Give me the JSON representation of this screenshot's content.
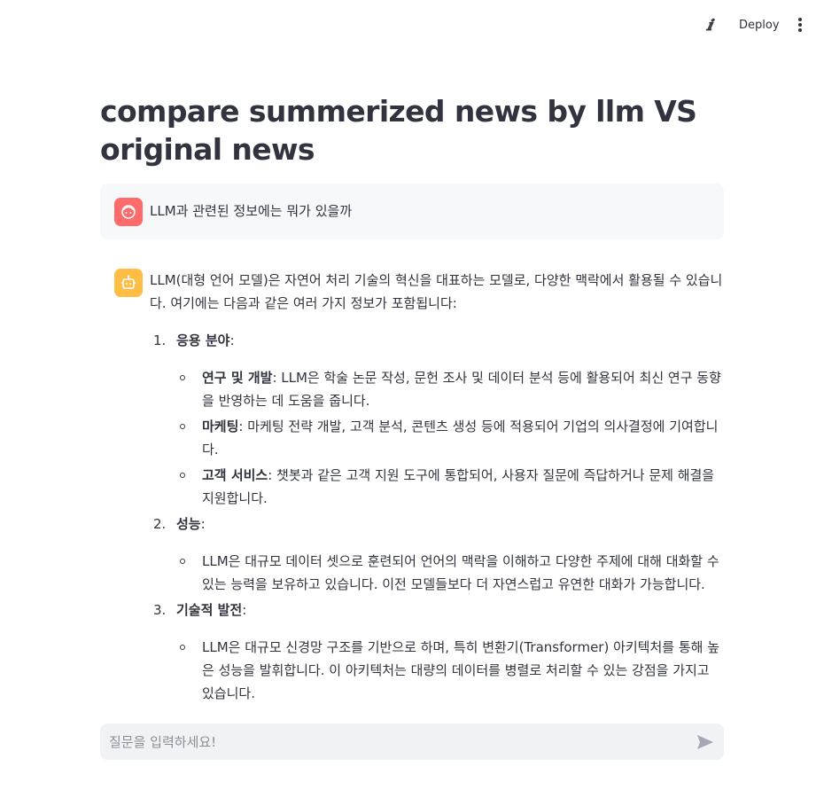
{
  "header": {
    "info_icon": "ⅈ",
    "deploy_label": "Deploy",
    "menu_icon": "vertical-ellipsis-icon"
  },
  "page": {
    "title": "compare summerized news by llm VS original news"
  },
  "messages": {
    "user": {
      "avatar_icon": "user-face-icon",
      "avatar_color": "#ff6b6b",
      "text": "LLM과 관련된 정보에는 뭐가 있을까"
    },
    "assistant": {
      "avatar_icon": "robot-icon",
      "avatar_color": "#ffbd45",
      "intro": "LLM(대형 언어 모델)은 자연어 처리 기술의 혁신을 대표하는 모델로, 다양한 맥락에서 활용될 수 있습니다. 여기에는 다음과 같은 여러 가지 정보가 포함됩니다:",
      "sections": [
        {
          "num": "1.",
          "heading": "응용 분야",
          "items": [
            {
              "label": "연구 및 개발",
              "text": ": LLM은 학술 논문 작성, 문헌 조사 및 데이터 분석 등에 활용되어 최신 연구 동향을 반영하는 데 도움을 줍니다."
            },
            {
              "label": "마케팅",
              "text": ": 마케팅 전략 개발, 고객 분석, 콘텐츠 생성 등에 적용되어 기업의 의사결정에 기여합니다."
            },
            {
              "label": "고객 서비스",
              "text": ": 챗봇과 같은 고객 지원 도구에 통합되어, 사용자 질문에 즉답하거나 문제 해결을 지원합니다."
            }
          ]
        },
        {
          "num": "2.",
          "heading": "성능",
          "items": [
            {
              "label": "",
              "text": "LLM은 대규모 데이터 셋으로 훈련되어 언어의 맥락을 이해하고 다양한 주제에 대해 대화할 수 있는 능력을 보유하고 있습니다. 이전 모델들보다 더 자연스럽고 유연한 대화가 가능합니다."
            }
          ]
        },
        {
          "num": "3.",
          "heading": "기술적 발전",
          "items": [
            {
              "label": "",
              "text": "LLM은 대규모 신경망 구조를 기반으로 하며, 특히 변환기(Transformer) 아키텍처를 통해 높은 성능을 발휘합니다. 이 아키텍처는 대량의 데이터를 병렬로 처리할 수 있는 강점을 가지고 있습니다."
            }
          ]
        }
      ]
    }
  },
  "chat_input": {
    "placeholder": "질문을 입력하세요!",
    "value": "",
    "send_icon": "send-arrow-icon"
  }
}
